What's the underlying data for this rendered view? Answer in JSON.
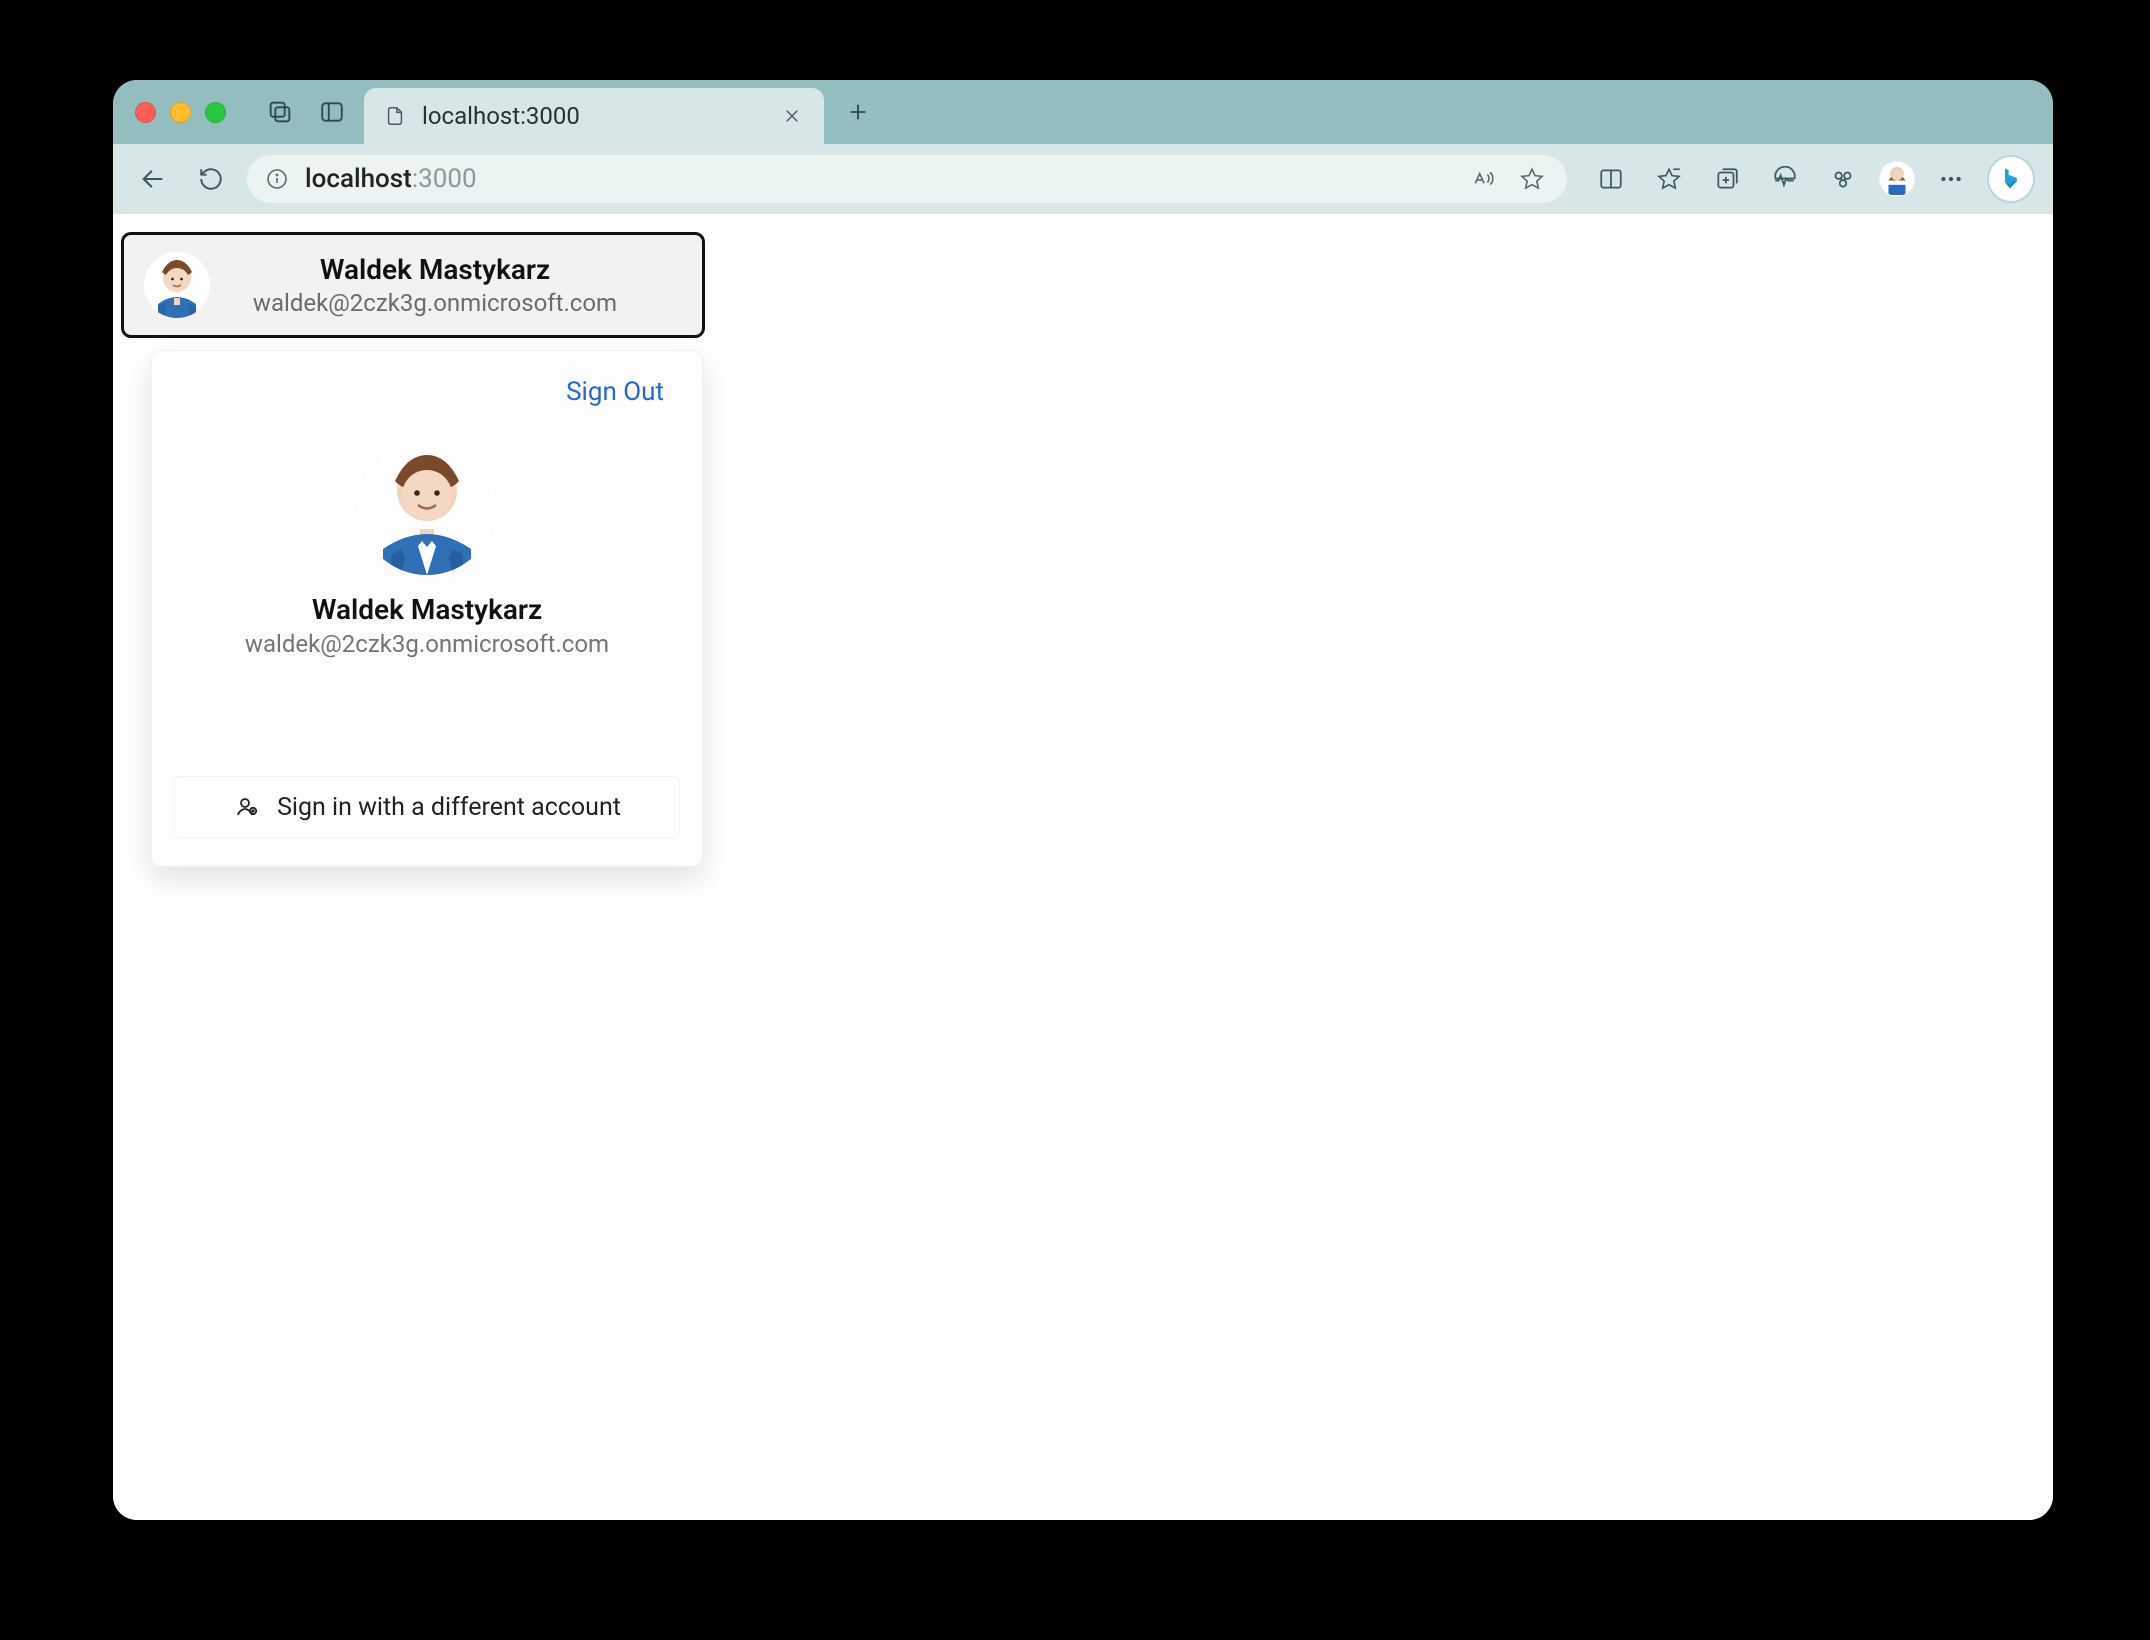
{
  "browser": {
    "tab": {
      "title": "localhost:3000"
    },
    "address": {
      "host": "localhost",
      "path": ":3000"
    }
  },
  "login": {
    "header": {
      "name": "Waldek Mastykarz",
      "email": "waldek@2czk3g.onmicrosoft.com"
    },
    "panel": {
      "signout_label": "Sign Out",
      "name": "Waldek Mastykarz",
      "email": "waldek@2czk3g.onmicrosoft.com",
      "alt_signin_label": "Sign in with a different account"
    }
  }
}
